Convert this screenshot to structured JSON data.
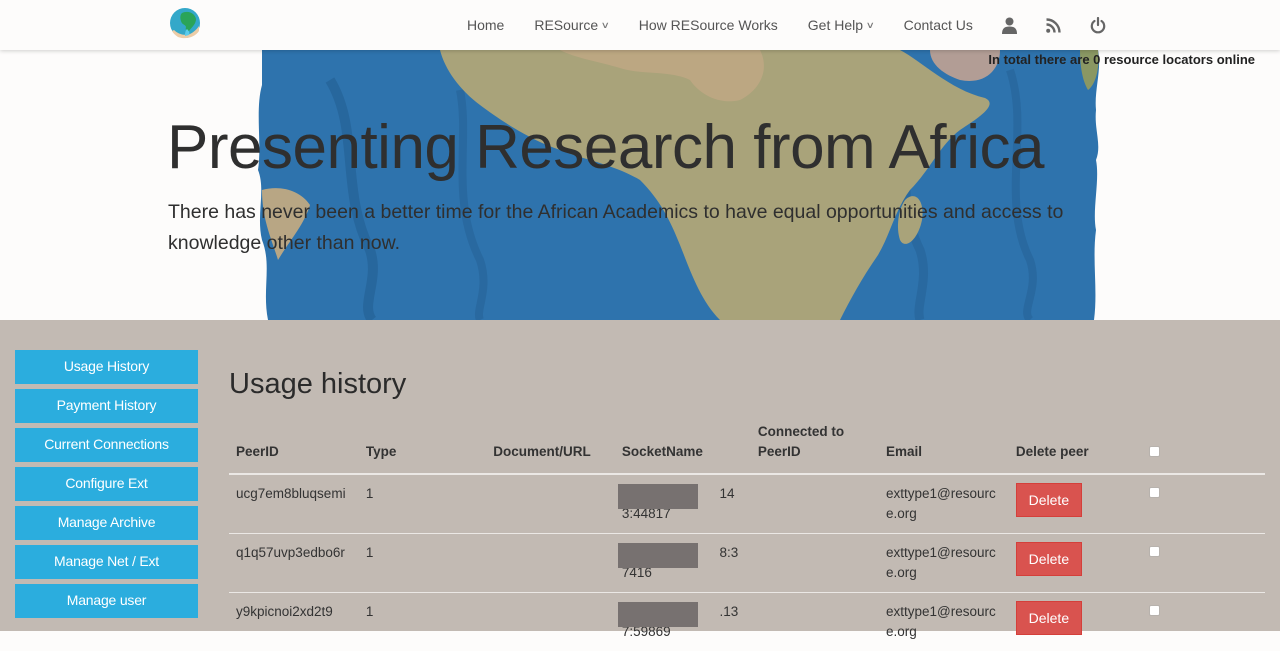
{
  "navbar": {
    "logo_alt": "RESource globe logo",
    "items": [
      {
        "label": "Home",
        "has_dropdown": false
      },
      {
        "label": "RESource",
        "has_dropdown": true
      },
      {
        "label": "How RESource Works",
        "has_dropdown": false
      },
      {
        "label": "Get Help",
        "has_dropdown": true
      },
      {
        "label": "Contact Us",
        "has_dropdown": false
      }
    ],
    "caret": "∨",
    "icons": [
      "user-icon",
      "rss-icon",
      "power-icon"
    ]
  },
  "hero": {
    "online_status": "In total there are 0 resource locators online",
    "title": "Presenting Research from Africa",
    "subtitle": "There has never been a better time for the African Academics to have equal opportunities and access to knowledge other than now."
  },
  "sidebar": {
    "items": [
      {
        "label": "Usage History"
      },
      {
        "label": "Payment History"
      },
      {
        "label": "Current Connections"
      },
      {
        "label": "Configure Ext"
      },
      {
        "label": "Manage Archive"
      },
      {
        "label": "Manage Net / Ext"
      },
      {
        "label": "Manage user"
      }
    ]
  },
  "main": {
    "title": "Usage history",
    "table": {
      "headers": [
        "PeerID",
        "Type",
        "Document/URL",
        "SocketName",
        "Connected to PeerID",
        "Email",
        "Delete peer",
        ""
      ],
      "rows": [
        {
          "peer_id": "ucg7em8bluqsemi",
          "type": "1",
          "document_url": "",
          "socket_name": "143:44817",
          "socket_redacted": true,
          "connected_to": "",
          "email": "exttype1@resource.org",
          "delete_label": "Delete",
          "checked": false
        },
        {
          "peer_id": "q1q57uvp3edbo6r",
          "type": "1",
          "document_url": "",
          "socket_name": "8:37416",
          "socket_redacted": true,
          "connected_to": "",
          "email": "exttype1@resource.org",
          "delete_label": "Delete",
          "checked": false
        },
        {
          "peer_id": "y9kpicnoi2xd2t9",
          "type": "1",
          "document_url": "",
          "socket_name": ".137:59869",
          "socket_redacted": true,
          "connected_to": "",
          "email": "exttype1@resource.org",
          "delete_label": "Delete",
          "checked": false
        }
      ]
    }
  },
  "colors": {
    "sidebar_button": "#2badde",
    "delete_button": "#d9534f",
    "main_background": "#c2bab3",
    "redaction": "#777170"
  }
}
